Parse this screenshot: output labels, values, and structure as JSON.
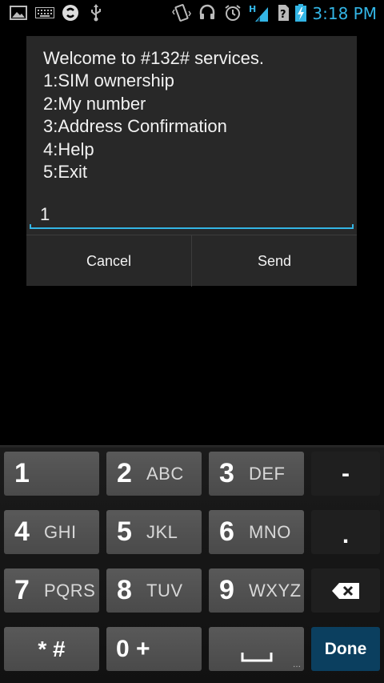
{
  "status_bar": {
    "left_icons": [
      "gallery-icon",
      "keyboard-icon",
      "sync-icon",
      "usb-icon"
    ],
    "right_icons": [
      "vibrate-icon",
      "headset-icon",
      "alarm-icon",
      "signal-hplus-icon",
      "unknown-sim-icon",
      "battery-charging-icon"
    ],
    "network_type": "H",
    "time": "3:18 PM",
    "accent_color": "#33b5e5"
  },
  "dialog": {
    "message_lines": [
      "Welcome to #132# services.",
      "1:SIM ownership",
      "2:My number",
      "3:Address Confirmation",
      "4:Help",
      "5:Exit"
    ],
    "input_value": "1",
    "cancel_label": "Cancel",
    "send_label": "Send"
  },
  "keypad": {
    "keys": [
      {
        "digit": "1",
        "letters": ""
      },
      {
        "digit": "2",
        "letters": "ABC"
      },
      {
        "digit": "3",
        "letters": "DEF"
      },
      {
        "label": "-"
      },
      {
        "digit": "4",
        "letters": "GHI"
      },
      {
        "digit": "5",
        "letters": "JKL"
      },
      {
        "digit": "6",
        "letters": "MNO"
      },
      {
        "label": "."
      },
      {
        "digit": "7",
        "letters": "PQRS"
      },
      {
        "digit": "8",
        "letters": "TUV"
      },
      {
        "digit": "9",
        "letters": "WXYZ"
      },
      {
        "icon": "backspace-icon"
      },
      {
        "label": "* #"
      },
      {
        "label": "0 +"
      },
      {
        "icon": "space-icon"
      },
      {
        "label": "Done"
      }
    ]
  }
}
